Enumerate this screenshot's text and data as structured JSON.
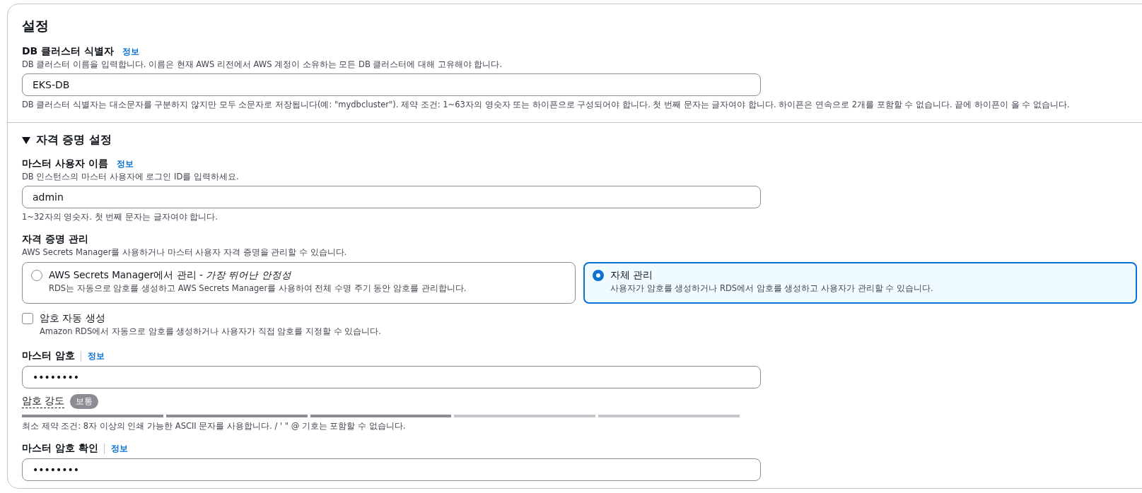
{
  "section": {
    "title": "설정"
  },
  "cluster_identifier": {
    "label": "DB 클러스터 식별자",
    "info": "정보",
    "info_separator": false,
    "description": "DB 클러스터 이름을 입력합니다. 이름은 현재 AWS 리전에서 AWS 계정이 소유하는 모든 DB 클러스터에 대해 고유해야 합니다.",
    "value": "EKS-DB",
    "constraint": "DB 클러스터 식별자는 대소문자를 구분하지 않지만 모두 소문자로 저장됩니다(예: \"mydbcluster\"). 제약 조건: 1~63자의 영숫자 또는 하이픈으로 구성되어야 합니다. 첫 번째 문자는 글자여야 합니다. 하이픈은 연속으로 2개를 포함할 수 없습니다. 끝에 하이픈이 올 수 없습니다."
  },
  "credentials": {
    "title": "자격 증명 설정",
    "expanded": true,
    "master_username": {
      "label": "마스터 사용자 이름",
      "info": "정보",
      "info_separator": false,
      "description": "DB 인스턴스의 마스터 사용자에 로그인 ID를 입력하세요.",
      "value": "admin",
      "constraint": "1~32자의 영숫자. 첫 번째 문자는 글자여야 합니다."
    },
    "credential_management": {
      "label": "자격 증명 관리",
      "description": "AWS Secrets Manager를 사용하거나 마스터 사용자 자격 증명을 관리할 수 있습니다.",
      "options": [
        {
          "title": "AWS Secrets Manager에서 관리 - *가장 뛰어난 안정성*",
          "description": "RDS는 자동으로 암호를 생성하고 AWS Secrets Manager를 사용하여 전체 수명 주기 동안 암호를 관리합니다.",
          "selected": false
        },
        {
          "title": "자체 관리",
          "description": "사용자가 암호를 생성하거나 RDS에서 암호를 생성하고 사용자가 관리할 수 있습니다.",
          "selected": true
        }
      ]
    },
    "auto_generate_password": {
      "label": "암호 자동 생성",
      "description": "Amazon RDS에서 자동으로 암호를 생성하거나 사용자가 직접 암호를 지정할 수 있습니다.",
      "checked": false
    },
    "master_password": {
      "label": "마스터 암호",
      "info": "정보",
      "info_separator": true,
      "value": "••••••••",
      "strength": {
        "label": "암호 강도",
        "badge": "보통",
        "level": 0.6
      },
      "constraint": "최소 제약 조건: 8자 이상의 인쇄 가능한 ASCII 문자를 사용합니다. / ' \" @ 기호는 포함할 수 없습니다."
    },
    "confirm_password": {
      "label": "마스터 암호 확인",
      "info": "정보",
      "info_separator": true,
      "value": "••••••••"
    }
  }
}
